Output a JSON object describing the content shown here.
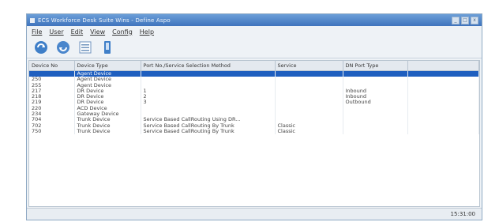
{
  "window": {
    "title": "ECS Workforce Desk Suite Wins - Define Aspo",
    "controls": [
      "_",
      "□",
      "x"
    ]
  },
  "menu": [
    "File",
    "User",
    "Edit",
    "View",
    "Config",
    "Help"
  ],
  "toolbar": {
    "icons": [
      "refresh-icon",
      "sync-icon",
      "list-icon",
      "device-icon"
    ]
  },
  "table": {
    "columns": [
      "Device No",
      "Device Type",
      "Port No./Service Selection Method",
      "Service",
      "DN Port Type"
    ],
    "rows": [
      [
        "",
        "Agent Device",
        "",
        "",
        ""
      ],
      [
        "250",
        "Agent Device",
        "",
        "",
        ""
      ],
      [
        "255",
        "Agent Device",
        "",
        "",
        ""
      ],
      [
        "217",
        "DR Device",
        "1",
        "",
        "Inbound"
      ],
      [
        "218",
        "DR Device",
        "2",
        "",
        "Inbound"
      ],
      [
        "219",
        "DR Device",
        "3",
        "",
        "Outbound"
      ],
      [
        "220",
        "ACD Device",
        "",
        "",
        ""
      ],
      [
        "234",
        "Gateway Device",
        "",
        "",
        ""
      ],
      [
        "704",
        "Trunk Device",
        "Service Based CallRouting Using DR...",
        "",
        ""
      ],
      [
        "702",
        "Trunk Device",
        "Service Based CallRouting By Trunk",
        "Classic",
        ""
      ],
      [
        "750",
        "Trunk Device",
        "Service Based CallRouting By Trunk",
        "Classic",
        ""
      ]
    ],
    "selected_row": 0
  },
  "status": {
    "clock": "15:31:00"
  }
}
